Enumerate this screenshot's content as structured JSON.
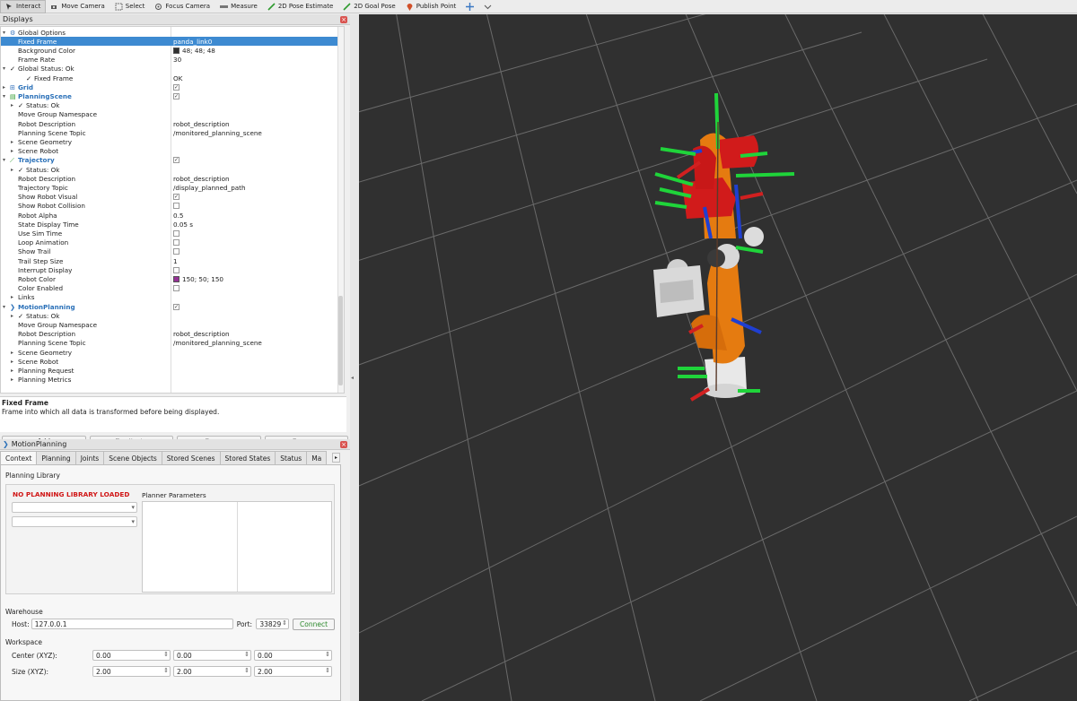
{
  "toolbar": {
    "tools": [
      {
        "label": "Interact",
        "icon": "interact-icon"
      },
      {
        "label": "Move Camera",
        "icon": "camera-icon"
      },
      {
        "label": "Select",
        "icon": "select-icon"
      },
      {
        "label": "Focus Camera",
        "icon": "focus-icon"
      },
      {
        "label": "Measure",
        "icon": "measure-icon"
      },
      {
        "label": "2D Pose Estimate",
        "icon": "pose-estimate-icon"
      },
      {
        "label": "2D Goal Pose",
        "icon": "goal-pose-icon"
      },
      {
        "label": "Publish Point",
        "icon": "publish-point-icon"
      }
    ]
  },
  "displays": {
    "title": "Displays",
    "rows": [
      {
        "label": "Global Options",
        "value": ""
      },
      {
        "label": "Fixed Frame",
        "value": "panda_link0"
      },
      {
        "label": "Background Color",
        "value": "48; 48; 48"
      },
      {
        "label": "Frame Rate",
        "value": "30"
      },
      {
        "label": "Global Status: Ok",
        "value": ""
      },
      {
        "label": "Fixed Frame",
        "value": "OK"
      },
      {
        "label": "Grid",
        "value": ""
      },
      {
        "label": "PlanningScene",
        "value": ""
      },
      {
        "label": "Status: Ok",
        "value": ""
      },
      {
        "label": "Move Group Namespace",
        "value": ""
      },
      {
        "label": "Robot Description",
        "value": "robot_description"
      },
      {
        "label": "Planning Scene Topic",
        "value": "/monitored_planning_scene"
      },
      {
        "label": "Scene Geometry",
        "value": ""
      },
      {
        "label": "Scene Robot",
        "value": ""
      },
      {
        "label": "Trajectory",
        "value": ""
      },
      {
        "label": "Status: Ok",
        "value": ""
      },
      {
        "label": "Robot Description",
        "value": "robot_description"
      },
      {
        "label": "Trajectory Topic",
        "value": "/display_planned_path"
      },
      {
        "label": "Show Robot Visual",
        "value": ""
      },
      {
        "label": "Show Robot Collision",
        "value": ""
      },
      {
        "label": "Robot Alpha",
        "value": "0.5"
      },
      {
        "label": "State Display Time",
        "value": "0.05 s"
      },
      {
        "label": "Use Sim Time",
        "value": ""
      },
      {
        "label": "Loop Animation",
        "value": ""
      },
      {
        "label": "Show Trail",
        "value": ""
      },
      {
        "label": "Trail Step Size",
        "value": "1"
      },
      {
        "label": "Interrupt Display",
        "value": ""
      },
      {
        "label": "Robot Color",
        "value": "150; 50; 150"
      },
      {
        "label": "Color Enabled",
        "value": ""
      },
      {
        "label": "Links",
        "value": ""
      },
      {
        "label": "MotionPlanning",
        "value": ""
      },
      {
        "label": "Status: Ok",
        "value": ""
      },
      {
        "label": "Move Group Namespace",
        "value": ""
      },
      {
        "label": "Robot Description",
        "value": "robot_description"
      },
      {
        "label": "Planning Scene Topic",
        "value": "/monitored_planning_scene"
      },
      {
        "label": "Scene Geometry",
        "value": ""
      },
      {
        "label": "Scene Robot",
        "value": ""
      },
      {
        "label": "Planning Request",
        "value": ""
      },
      {
        "label": "Planning Metrics",
        "value": ""
      }
    ],
    "background_color_hex": "#303030",
    "robot_color_hex": "#963296"
  },
  "description": {
    "title": "Fixed Frame",
    "text": "Frame into which all data is transformed before being displayed."
  },
  "display_buttons": {
    "add": "Add",
    "duplicate": "Duplicate",
    "remove": "Remove",
    "rename": "Rename"
  },
  "motion_planning": {
    "title": "MotionPlanning",
    "tabs": [
      "Context",
      "Planning",
      "Joints",
      "Scene Objects",
      "Stored Scenes",
      "Stored States",
      "Status",
      "Ma"
    ],
    "planning_library_label": "Planning Library",
    "no_library": "NO PLANNING LIBRARY LOADED",
    "planner_params_label": "Planner Parameters",
    "warehouse_label": "Warehouse",
    "host_label": "Host:",
    "host_value": "127.0.0.1",
    "port_label": "Port:",
    "port_value": "33829",
    "connect_label": "Connect",
    "workspace_label": "Workspace",
    "center_label": "Center (XYZ):",
    "center_values": [
      "0.00",
      "0.00",
      "0.00"
    ],
    "size_label": "Size (XYZ):",
    "size_values": [
      "2.00",
      "2.00",
      "2.00"
    ]
  }
}
